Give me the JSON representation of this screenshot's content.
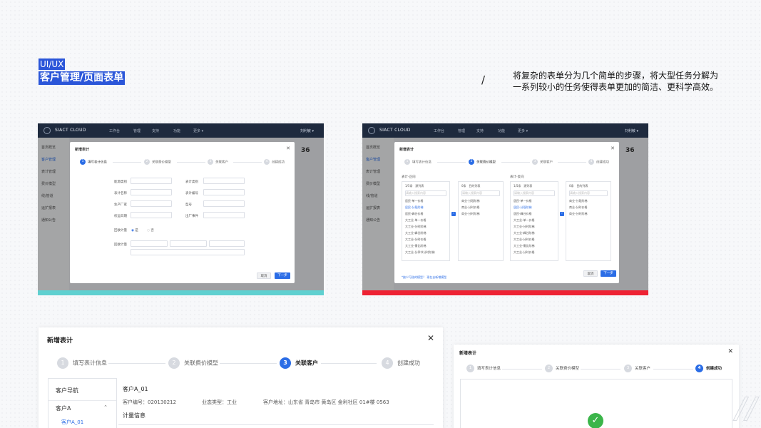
{
  "header": {
    "line1": "UI/UX",
    "line2": "客户管理/页面表单",
    "slash": "/",
    "desc_line1": "将复杂的表单分为几个简单的步骤，将大型任务分解为",
    "desc_line2": "一系列较小的任务使得表单更加的简洁、更科学高效。"
  },
  "app": {
    "brand": "SIACT CLOUD",
    "nav": [
      "工作台",
      "管理",
      "支持",
      "功能",
      "更多 ▾"
    ],
    "user": "刘利敏 ▾",
    "side": [
      "首页概览",
      "客户管理",
      "表计管理",
      "费价模型",
      "线/管道",
      "运扩报表",
      "通知公告"
    ],
    "card_number": "36"
  },
  "modal_left": {
    "title": "新增表计",
    "steps": [
      "填写表计信息",
      "关联费价模型",
      "关联客户",
      "创建成功"
    ],
    "fields_left": [
      "能源类别",
      "表计名称",
      "生产厂家",
      "校运日期"
    ],
    "fields_right": [
      "表计类别",
      "表计编号",
      "型号",
      "出厂事件"
    ],
    "radio_label": "回收计量",
    "radio_yes": "是",
    "radio_no": "否",
    "extra_label": "回收计量",
    "cancel": "取消",
    "next": "下一步"
  },
  "modal_right": {
    "title": "新增表计",
    "steps": [
      "填写表计信息",
      "关联费价模型",
      "关联客户",
      "创建成功"
    ],
    "group1": "表计-正向",
    "group2": "表计-反向",
    "list_header_a": "1/5条",
    "list_header_b": "源列表",
    "list_header_c": "0条",
    "list_header_d": "目的列表",
    "search_placeholder": "请输入搜索内容",
    "left_rows": [
      "居民-单一价格",
      "居民-分段阶梯",
      "居民-峰谷价格",
      "大工业-单一价格",
      "大工业-分时阶梯",
      "大工业-峰谷阶梯",
      "大工业-分时价格",
      "大工业-需比阶梯",
      "大工业-分季节分时阶梯",
      "大工业-分时价格"
    ],
    "target_rows": [
      "商业-分段阶梯",
      "商业-分时价格",
      "商业-分时阶梯"
    ],
    "hint": "*缺少可选的模型？ 现在去新增模型",
    "cancel": "取消",
    "next": "下一步"
  },
  "modal_bottom": {
    "title": "新增表计",
    "steps": [
      "填写表计信息",
      "关联费价模型",
      "关联客户",
      "创建成功"
    ],
    "nav_header": "客户导航",
    "nav_item": "客户A",
    "nav_sub": "客户A_01",
    "customer_name": "客户A_01",
    "customer_no": "客户编号：020130212",
    "biz_type": "业态类型：工业",
    "address": "客户地址：山东省 青岛市 黄岛区 金利社区 01#楼 0563",
    "section": "计量信息"
  },
  "modal_success": {
    "title": "新增表计",
    "steps": [
      "填写表计信息",
      "关联费价模型",
      "关联客户",
      "创建成功"
    ]
  },
  "colors": {
    "accent": "#2b6de6",
    "strip_left": "#5fd0d0",
    "strip_right": "#ee2233",
    "success": "#3bb54a"
  }
}
